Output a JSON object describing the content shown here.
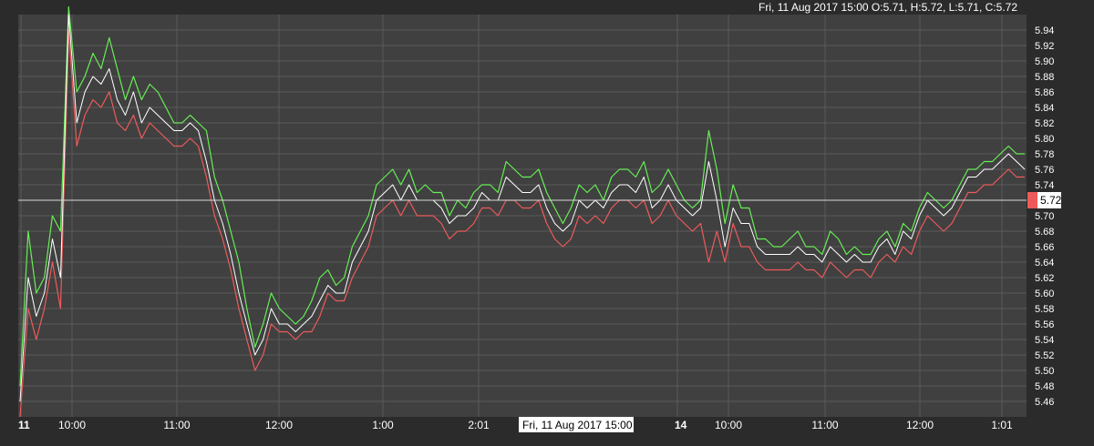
{
  "header": {
    "ohlc_readout": "Fri, 11 Aug 2017 15:00  O:5.71, H:5.72, L:5.71, C:5.72"
  },
  "crosshair": {
    "time_label": "Fri, 11 Aug 2017 15:00",
    "price_label": "5.72",
    "price": 5.72
  },
  "colors": {
    "background": "#2b2b2b",
    "plot_background": "#404040",
    "grid": "#5a5a5a",
    "high_line": "#66ee55",
    "low_line": "#ee5a5a",
    "close_line": "#ffffff",
    "crosshair": "#d8d8d8",
    "price_badge": "#ee5a5a"
  },
  "chart_data": {
    "type": "line",
    "title": "",
    "xlabel": "",
    "ylabel": "",
    "ylim": [
      5.44,
      5.96
    ],
    "y_ticks": [
      "5.46",
      "5.48",
      "5.50",
      "5.52",
      "5.54",
      "5.56",
      "5.58",
      "5.60",
      "5.62",
      "5.64",
      "5.66",
      "5.68",
      "5.70",
      "5.72",
      "5.74",
      "5.76",
      "5.78",
      "5.80",
      "5.82",
      "5.84",
      "5.86",
      "5.88",
      "5.90",
      "5.92",
      "5.94"
    ],
    "x_ticks": [
      {
        "label": "11",
        "major": true
      },
      {
        "label": "10:00",
        "major": false
      },
      {
        "label": "11:00",
        "major": false
      },
      {
        "label": "12:00",
        "major": false
      },
      {
        "label": "1:00",
        "major": false
      },
      {
        "label": "2:01",
        "major": false
      },
      {
        "label": "14",
        "major": true
      },
      {
        "label": "10:00",
        "major": false
      },
      {
        "label": "11:00",
        "major": false
      },
      {
        "label": "12:00",
        "major": false
      },
      {
        "label": "1:01",
        "major": false
      }
    ],
    "grid": true,
    "legend": "none",
    "series": [
      {
        "key": "high",
        "values": [
          5.48,
          5.68,
          5.6,
          5.62,
          5.7,
          5.68,
          5.97,
          5.86,
          5.88,
          5.91,
          5.89,
          5.93,
          5.89,
          5.85,
          5.88,
          5.85,
          5.87,
          5.86,
          5.84,
          5.82,
          5.82,
          5.83,
          5.82,
          5.81,
          5.75,
          5.72,
          5.68,
          5.64,
          5.58,
          5.53,
          5.56,
          5.6,
          5.58,
          5.57,
          5.56,
          5.57,
          5.59,
          5.62,
          5.63,
          5.61,
          5.62,
          5.66,
          5.68,
          5.7,
          5.74,
          5.75,
          5.76,
          5.74,
          5.76,
          5.73,
          5.74,
          5.73,
          5.73,
          5.7,
          5.72,
          5.71,
          5.73,
          5.74,
          5.74,
          5.73,
          5.77,
          5.76,
          5.75,
          5.75,
          5.76,
          5.73,
          5.71,
          5.69,
          5.71,
          5.74,
          5.73,
          5.74,
          5.72,
          5.75,
          5.76,
          5.76,
          5.75,
          5.77,
          5.73,
          5.74,
          5.76,
          5.74,
          5.72,
          5.71,
          5.72,
          5.81,
          5.76,
          5.69,
          5.74,
          5.71,
          5.71,
          5.67,
          5.67,
          5.66,
          5.66,
          5.67,
          5.68,
          5.66,
          5.66,
          5.65,
          5.68,
          5.67,
          5.65,
          5.66,
          5.65,
          5.65,
          5.67,
          5.68,
          5.66,
          5.69,
          5.68,
          5.71,
          5.73,
          5.72,
          5.71,
          5.72,
          5.74,
          5.76,
          5.76,
          5.77,
          5.77,
          5.78,
          5.79,
          5.78,
          5.78
        ]
      },
      {
        "key": "low",
        "values": [
          5.44,
          5.58,
          5.54,
          5.58,
          5.64,
          5.58,
          5.94,
          5.79,
          5.83,
          5.85,
          5.84,
          5.86,
          5.82,
          5.81,
          5.83,
          5.8,
          5.82,
          5.81,
          5.8,
          5.79,
          5.79,
          5.8,
          5.79,
          5.75,
          5.7,
          5.67,
          5.63,
          5.58,
          5.54,
          5.5,
          5.52,
          5.56,
          5.55,
          5.55,
          5.54,
          5.55,
          5.55,
          5.57,
          5.6,
          5.59,
          5.59,
          5.62,
          5.64,
          5.66,
          5.7,
          5.71,
          5.72,
          5.7,
          5.72,
          5.7,
          5.7,
          5.7,
          5.69,
          5.67,
          5.68,
          5.68,
          5.69,
          5.71,
          5.71,
          5.7,
          5.72,
          5.72,
          5.71,
          5.71,
          5.72,
          5.69,
          5.67,
          5.66,
          5.67,
          5.7,
          5.69,
          5.7,
          5.69,
          5.71,
          5.72,
          5.72,
          5.71,
          5.72,
          5.69,
          5.7,
          5.72,
          5.7,
          5.69,
          5.68,
          5.69,
          5.64,
          5.68,
          5.64,
          5.69,
          5.66,
          5.66,
          5.64,
          5.63,
          5.63,
          5.63,
          5.63,
          5.64,
          5.63,
          5.63,
          5.62,
          5.64,
          5.63,
          5.62,
          5.63,
          5.63,
          5.62,
          5.64,
          5.65,
          5.64,
          5.66,
          5.65,
          5.68,
          5.7,
          5.69,
          5.68,
          5.69,
          5.71,
          5.73,
          5.73,
          5.74,
          5.74,
          5.75,
          5.76,
          5.75,
          5.75
        ]
      },
      {
        "key": "close",
        "values": [
          5.46,
          5.62,
          5.57,
          5.6,
          5.67,
          5.62,
          5.96,
          5.82,
          5.86,
          5.88,
          5.87,
          5.89,
          5.85,
          5.83,
          5.86,
          5.82,
          5.84,
          5.83,
          5.82,
          5.81,
          5.81,
          5.82,
          5.81,
          5.77,
          5.72,
          5.69,
          5.65,
          5.6,
          5.56,
          5.52,
          5.54,
          5.58,
          5.56,
          5.56,
          5.55,
          5.56,
          5.57,
          5.59,
          5.61,
          5.6,
          5.6,
          5.64,
          5.66,
          5.68,
          5.72,
          5.73,
          5.74,
          5.72,
          5.74,
          5.72,
          5.72,
          5.72,
          5.71,
          5.69,
          5.7,
          5.7,
          5.71,
          5.73,
          5.72,
          5.72,
          5.75,
          5.74,
          5.73,
          5.73,
          5.74,
          5.71,
          5.69,
          5.68,
          5.69,
          5.72,
          5.71,
          5.72,
          5.71,
          5.73,
          5.74,
          5.74,
          5.73,
          5.75,
          5.71,
          5.72,
          5.74,
          5.72,
          5.71,
          5.7,
          5.71,
          5.77,
          5.72,
          5.66,
          5.71,
          5.69,
          5.69,
          5.66,
          5.65,
          5.65,
          5.65,
          5.65,
          5.66,
          5.65,
          5.65,
          5.64,
          5.66,
          5.65,
          5.64,
          5.65,
          5.64,
          5.64,
          5.66,
          5.67,
          5.65,
          5.68,
          5.67,
          5.7,
          5.72,
          5.71,
          5.7,
          5.71,
          5.73,
          5.75,
          5.75,
          5.76,
          5.76,
          5.77,
          5.78,
          5.77,
          5.76
        ]
      }
    ]
  }
}
